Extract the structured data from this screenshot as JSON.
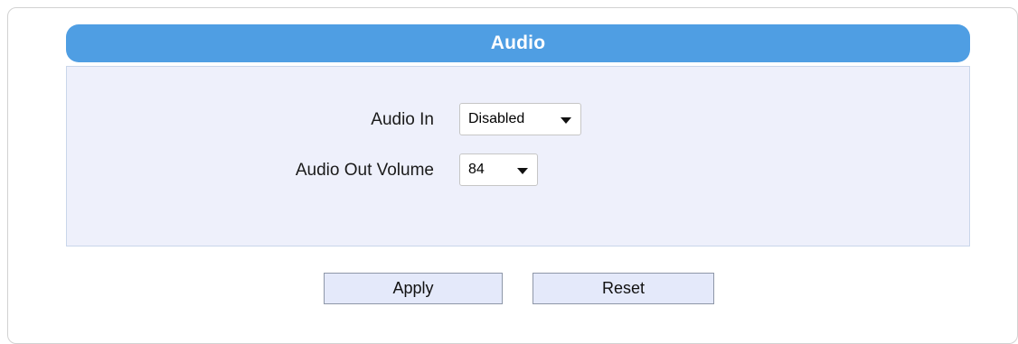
{
  "section": {
    "title": "Audio"
  },
  "fields": {
    "audio_in": {
      "label": "Audio In",
      "value": "Disabled"
    },
    "audio_out_volume": {
      "label": "Audio Out Volume",
      "value": "84"
    }
  },
  "buttons": {
    "apply_label": "Apply",
    "reset_label": "Reset"
  },
  "icons": {
    "dropdown": "chevron-down-icon"
  },
  "colors": {
    "header_bg": "#4f9ee3",
    "panel_bg": "#eef0fb",
    "button_bg": "#e4e9fa"
  }
}
